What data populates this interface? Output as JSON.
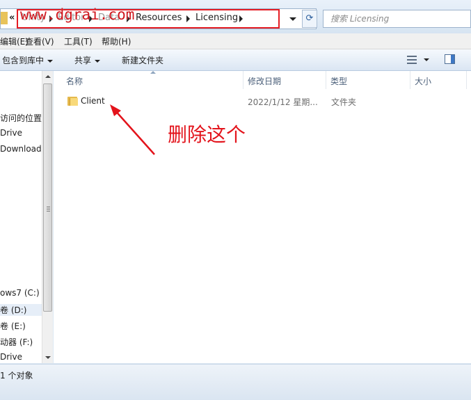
{
  "address": {
    "overflow_glyph": "«",
    "crumbs": [
      "Unity",
      "Editor",
      "Data",
      "Resources",
      "Licensing"
    ],
    "watermark": "www.dgrai.com",
    "refresh_glyph": "⟳"
  },
  "search": {
    "placeholder": "搜索 Licensing"
  },
  "menu": [
    "编辑(E)",
    "查看(V)",
    "工具(T)",
    "帮助(H)"
  ],
  "toolbar": {
    "include_library": "包含到库中",
    "share": "共享",
    "new_folder": "新建文件夹"
  },
  "nav": {
    "items": [
      "访问的位置",
      "Drive",
      "Downloads",
      "ows7 (C:)",
      "卷 (D:)",
      "卷 (E:)",
      "动器 (F:)",
      "Drive"
    ]
  },
  "columns": {
    "name": "名称",
    "modified": "修改日期",
    "type": "类型",
    "size": "大小"
  },
  "files": [
    {
      "name": "Client",
      "modified": "2022/1/12 星期...",
      "type": "文件夹",
      "size": ""
    }
  ],
  "annotation": {
    "text": "删除这个",
    "color": "#e3131b"
  },
  "status": {
    "text": "1 个对象"
  },
  "colors": {
    "accent": "#3f78c4",
    "annotation_red": "#e3131b"
  }
}
